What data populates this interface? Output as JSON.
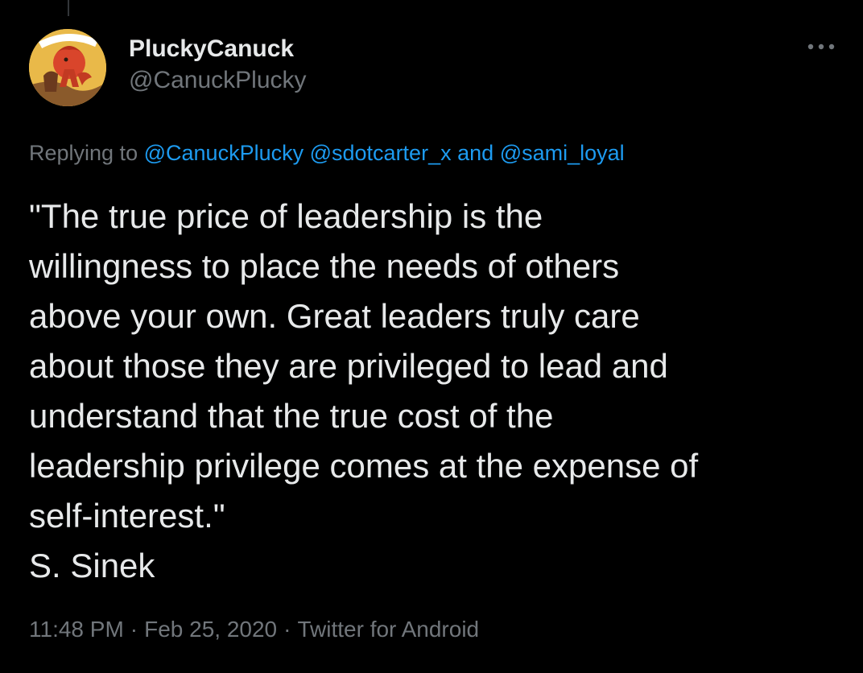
{
  "author": {
    "display_name": "PluckyCanuck",
    "handle": "@CanuckPlucky",
    "avatar_icon": "victory-poster-avatar",
    "avatar_text": "TO VICTORY"
  },
  "replying": {
    "prefix": "Replying to",
    "mentions": [
      "@CanuckPlucky",
      "@sdotcarter_x"
    ],
    "conjunction": "and",
    "last_mention": "@sami_loyal"
  },
  "tweet": {
    "text": "\"The true price of leadership is the\nwillingness to place the needs of others\nabove your own. Great leaders truly care\nabout those they are privileged to lead and\nunderstand that the true cost of the\nleadership privilege comes at the expense of\nself-interest.\"\nS. Sinek"
  },
  "meta": {
    "time": "11:48 PM",
    "date": "Feb 25, 2020",
    "source": "Twitter for Android",
    "separator": "·"
  },
  "icons": {
    "more": "more-horizontal-icon"
  },
  "colors": {
    "background": "#000000",
    "text": "#e7e9ea",
    "secondary": "#71767b",
    "link": "#1d9bf0"
  }
}
